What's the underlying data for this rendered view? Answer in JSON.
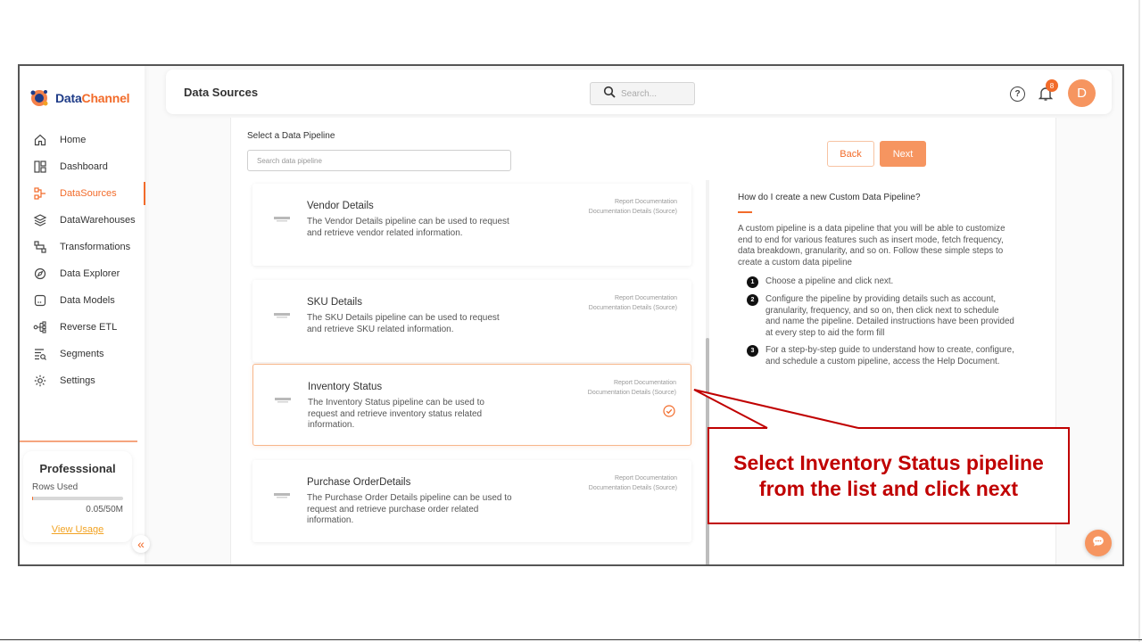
{
  "app": {
    "logo_part1": "Data",
    "logo_part2": "Channel"
  },
  "sidebar": {
    "items": [
      {
        "label": "Home",
        "icon": "home-icon",
        "active": false
      },
      {
        "label": "Dashboard",
        "icon": "dashboard-icon",
        "active": false
      },
      {
        "label": "DataSources",
        "icon": "datasources-icon",
        "active": true
      },
      {
        "label": "DataWarehouses",
        "icon": "layers-icon",
        "active": false
      },
      {
        "label": "Transformations",
        "icon": "transformations-icon",
        "active": false
      },
      {
        "label": "Data Explorer",
        "icon": "explorer-icon",
        "active": false
      },
      {
        "label": "Data Models",
        "icon": "models-icon",
        "active": false
      },
      {
        "label": "Reverse ETL",
        "icon": "reverse-etl-icon",
        "active": false
      },
      {
        "label": "Segments",
        "icon": "segments-icon",
        "active": false
      },
      {
        "label": "Settings",
        "icon": "gear-icon",
        "active": false
      }
    ],
    "plan": {
      "title": "Professsional",
      "rows_label": "Rows Used",
      "usage": "0.05/50M",
      "usage_fraction": 0.001,
      "link": "View Usage"
    }
  },
  "header": {
    "title": "Data Sources",
    "search_placeholder": "Search...",
    "help_label": "?",
    "notification_count": "8",
    "avatar_initial": "D"
  },
  "pipeline": {
    "label": "Select a Data Pipeline",
    "search_placeholder": "Search data pipeline",
    "cards": [
      {
        "title": "Vendor Details",
        "description": "The Vendor Details pipeline can be used to request and retrieve vendor related information.",
        "link1": "Report Documentation",
        "link2": "Documentation Details (Source)",
        "selected": false
      },
      {
        "title": "SKU Details",
        "description": "The SKU Details pipeline can be used to request and retrieve SKU related information.",
        "link1": "Report Documentation",
        "link2": "Documentation Details (Source)",
        "selected": false
      },
      {
        "title": "Inventory Status",
        "description": "The Inventory Status pipeline can be used to request and retrieve inventory status related information.",
        "link1": "Report Documentation",
        "link2": "Documentation Details (Source)",
        "selected": true
      },
      {
        "title": "Purchase OrderDetails",
        "description": "The Purchase Order Details pipeline can be used to request and retrieve purchase order related information.",
        "link1": "Report Documentation",
        "link2": "Documentation Details (Source)",
        "selected": false
      }
    ]
  },
  "actions": {
    "back": "Back",
    "next": "Next"
  },
  "help": {
    "title": "How do I create a new Custom Data Pipeline?",
    "intro": "A custom pipeline is a data pipeline that you will be able to customize end to end for various features such as insert mode, fetch frequency, data breakdown, granularity, and so on. Follow these simple steps to create a custom data pipeline",
    "steps": [
      {
        "num": "1",
        "text": "Choose a pipeline and click next."
      },
      {
        "num": "2",
        "text": "Configure the pipeline by providing details such as account, granularity, frequency, and so on, then click next to schedule and name the pipeline. Detailed instructions have been provided at every step to aid the form fill"
      },
      {
        "num": "3",
        "text": "For a step-by-step guide to understand how to create, configure, and schedule a custom pipeline, access the Help Document."
      }
    ]
  },
  "callout": {
    "text": "Select Inventory Status pipeline from the list and click next"
  },
  "colors": {
    "accent": "#f26b2a",
    "callout": "#c00000",
    "brand_blue": "#1f3c88"
  }
}
